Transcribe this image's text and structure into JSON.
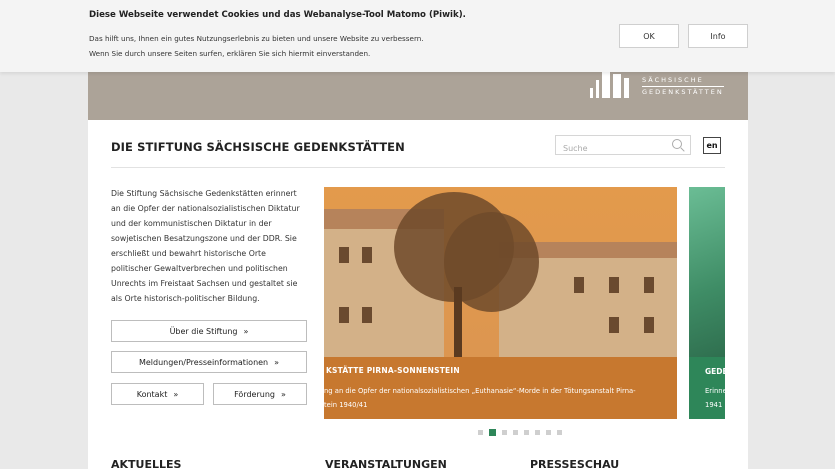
{
  "cookie_banner": {
    "title": "Diese Webseite verwendet Cookies und das Webanalyse-Tool Matomo (Piwik).",
    "text_line1": "Das hilft uns, Ihnen ein gutes Nutzungserlebnis zu bieten und unsere Website zu verbessern.",
    "text_line2": "Wenn Sie durch unsere Seiten surfen, erklären Sie sich hiermit einverstanden.",
    "ok_label": "OK",
    "info_label": "Info"
  },
  "logo": {
    "line1": "SÄCHSISCHE",
    "line2": "GEDENKSTÄTTEN"
  },
  "header": {
    "title": "DIE STIFTUNG SÄCHSISCHE GEDENKSTÄTTEN",
    "search_placeholder": "Suche",
    "lang_label": "en"
  },
  "intro": {
    "lines": [
      "Die Stiftung Sächsische Gedenkstätten erinnert",
      "an die Opfer der nationalsozialistischen Diktatur",
      "und der kommunistischen Diktatur in der",
      "sowjetischen Besatzungszone und der DDR. Sie",
      "erschließt und bewahrt historische Orte",
      "politischer Gewaltverbrechen und politischen",
      "Unrechts im Freistaat Sachsen und gestaltet sie",
      "als Orte historisch-politischer Bildung."
    ]
  },
  "buttons": {
    "about": "Über die Stiftung",
    "news": "Meldungen/Presseinformationen",
    "contact": "Kontakt",
    "funding": "Förderung",
    "arrow": "»"
  },
  "slider": {
    "current": {
      "title": "KSTÄTTE PIRNA-SONNENSTEIN",
      "desc_line1": "ng an die Opfer der nationalsozialistischen „Euthanasie“-Morde in der Tötungsanstalt Pirna-",
      "desc_line2": "tein 1940/41"
    },
    "next": {
      "title": "GEDE",
      "desc_line1": "Erinne",
      "desc_line2": "1941"
    },
    "dot_count": 8,
    "active_index": 1,
    "colors": {
      "current": "#c7782f",
      "next": "#2e8659"
    }
  },
  "sections": {
    "news": "AKTUELLES",
    "events": "VERANSTALTUNGEN",
    "press": "PRESSESCHAU"
  }
}
